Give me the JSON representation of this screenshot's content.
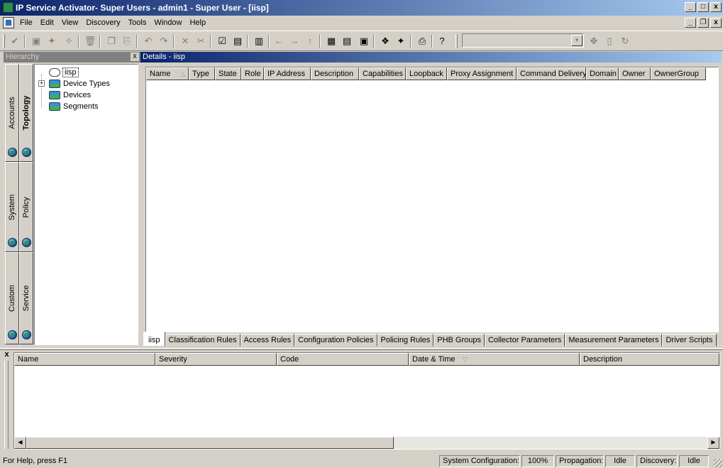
{
  "window": {
    "title": "IP Service Activator- Super Users - admin1 - Super User - [iisp]",
    "controls": [
      "_",
      "□",
      "x"
    ]
  },
  "menu": {
    "items": [
      "File",
      "Edit",
      "View",
      "Discovery",
      "Tools",
      "Window",
      "Help"
    ]
  },
  "toolbar": {
    "combo_value": ""
  },
  "hierarchy": {
    "title": "Hierarchy",
    "close": "x",
    "tabs": [
      "Accounts",
      "Topology",
      "System",
      "Policy",
      "Custom",
      "Service"
    ],
    "tree": [
      {
        "label": "iisp",
        "icon": "cloud-icon"
      },
      {
        "label": "Device Types",
        "icon": "folder-globe-icon",
        "expander": "+"
      },
      {
        "label": "Devices",
        "icon": "folder-globe-icon"
      },
      {
        "label": "Segments",
        "icon": "folder-globe-icon"
      }
    ]
  },
  "details": {
    "title": "Details - iisp",
    "columns": [
      "Name",
      "Type",
      "State",
      "Role",
      "IP Address",
      "Description",
      "Capabilities",
      "Loopback",
      "Proxy Assignment",
      "Command Delivery",
      "Domain",
      "Owner",
      "OwnerGroup"
    ],
    "tabs": [
      "iisp",
      "Classification Rules",
      "Access Rules",
      "Configuration Policies",
      "Policing Rules",
      "PHB Groups",
      "Collector Parameters",
      "Measurement Parameters",
      "Driver Scripts"
    ],
    "active_tab": "iisp"
  },
  "log": {
    "close": "x",
    "columns": [
      "Name",
      "Severity",
      "Code",
      "Date & Time",
      "Description"
    ]
  },
  "status": {
    "help": "For Help, press F1",
    "sysconf_label": "System Configuration:",
    "sysconf_value": "100%",
    "propagation_label": "Propagation:",
    "propagation_value": "Idle",
    "discovery_label": "Discovery:",
    "discovery_value": "Idle"
  }
}
